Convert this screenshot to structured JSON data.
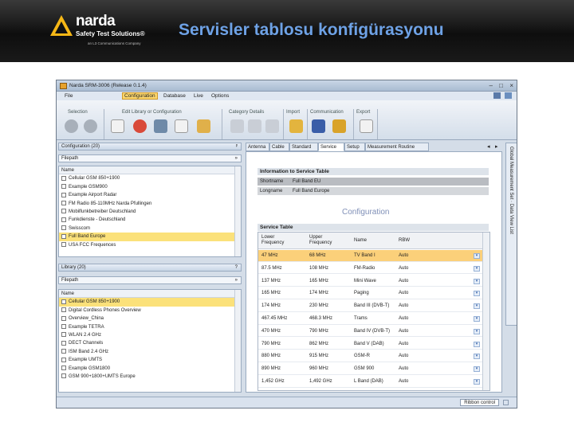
{
  "slide": {
    "title": "Servisler tablosu konfigürasyonu"
  },
  "logo": {
    "name": "narda",
    "subtitle": "Safety Test Solutions®",
    "tagline": "an L3 Communications Company"
  },
  "window": {
    "title": "Narda SRM-3006 (Release 0.1.4)",
    "controls": [
      "–",
      "□",
      "×"
    ],
    "menu": [
      "File",
      "Configuration",
      "Database",
      "Live",
      "Options"
    ],
    "active_menu": "Configuration",
    "ribbon_groups": [
      "Selection",
      "Edit Library or Configuration",
      "Category Details",
      "Import",
      "Communication",
      "Export"
    ],
    "config_panel": {
      "title": "Configuration (20)",
      "pin": "ᵖ",
      "filter_label": "Filepath",
      "column": "Name",
      "items": [
        "Cellular GSM 850+1900",
        "Example GSM900",
        "Example Airport Radar",
        "FM Radio 85-110MHz Narda Pfullingen",
        "Mobilfunkbetreiber Deutschland",
        "Funkdienste - Deutschland",
        "Swisscom",
        "Full Band Europe",
        "USA FCC Frequences"
      ],
      "selected": 7
    },
    "library_panel": {
      "title": "Library (20)",
      "pin": "?",
      "filter_label": "Filepath",
      "column": "Name",
      "items": [
        "Cellular GSM 850+1900",
        "Digital Cordless Phones Overview",
        "Overview_China",
        "Example TETRA",
        "WLAN 2.4 GHz",
        "DECT Channels",
        "ISM Band 2.4 GHz",
        "Example UMTS",
        "Example GSM1800",
        "GSM 900+1800+UMTS Europe"
      ],
      "selected": 0
    },
    "tabs": [
      "Antenna",
      "Cable",
      "Standard",
      "Service",
      "Setup",
      "Measurement Routine"
    ],
    "active_tab": "Service",
    "info_section": "Information to Service Table",
    "shortname_label": "Shortname",
    "shortname_value": "Full Band EU",
    "longname_label": "Longname",
    "longname_value": "Full Band Europe",
    "watermark": "Configuration",
    "table_section": "Service Table",
    "table_headers": [
      "Lower Frequency",
      "Upper Frequency",
      "Name",
      "RBW"
    ],
    "rows": [
      [
        "47 MHz",
        "68 MHz",
        "TV Band I",
        "Auto"
      ],
      [
        "87.5 MHz",
        "108 MHz",
        "FM-Radio",
        "Auto"
      ],
      [
        "137 MHz",
        "165 MHz",
        "Mini Wave",
        "Auto"
      ],
      [
        "165 MHz",
        "174 MHz",
        "Paging",
        "Auto"
      ],
      [
        "174 MHz",
        "230 MHz",
        "Band III (DVB-T)",
        "Auto"
      ],
      [
        "467.45 MHz",
        "468.3 MHz",
        "Trams",
        "Auto"
      ],
      [
        "470 MHz",
        "790 MHz",
        "Band IV (DVB-T)",
        "Auto"
      ],
      [
        "790 MHz",
        "862 MHz",
        "Band V (DAB)",
        "Auto"
      ],
      [
        "880 MHz",
        "915 MHz",
        "GSM-R",
        "Auto"
      ],
      [
        "890 MHz",
        "960 MHz",
        "GSM 900",
        "Auto"
      ],
      [
        "1,452 GHz",
        "1,492 GHz",
        "L Band (DAB)",
        "Auto"
      ]
    ],
    "selected_row": 0,
    "side_tabs": "Global Measurement Set  ·  Data View List",
    "status_button": "Ribbon control"
  }
}
